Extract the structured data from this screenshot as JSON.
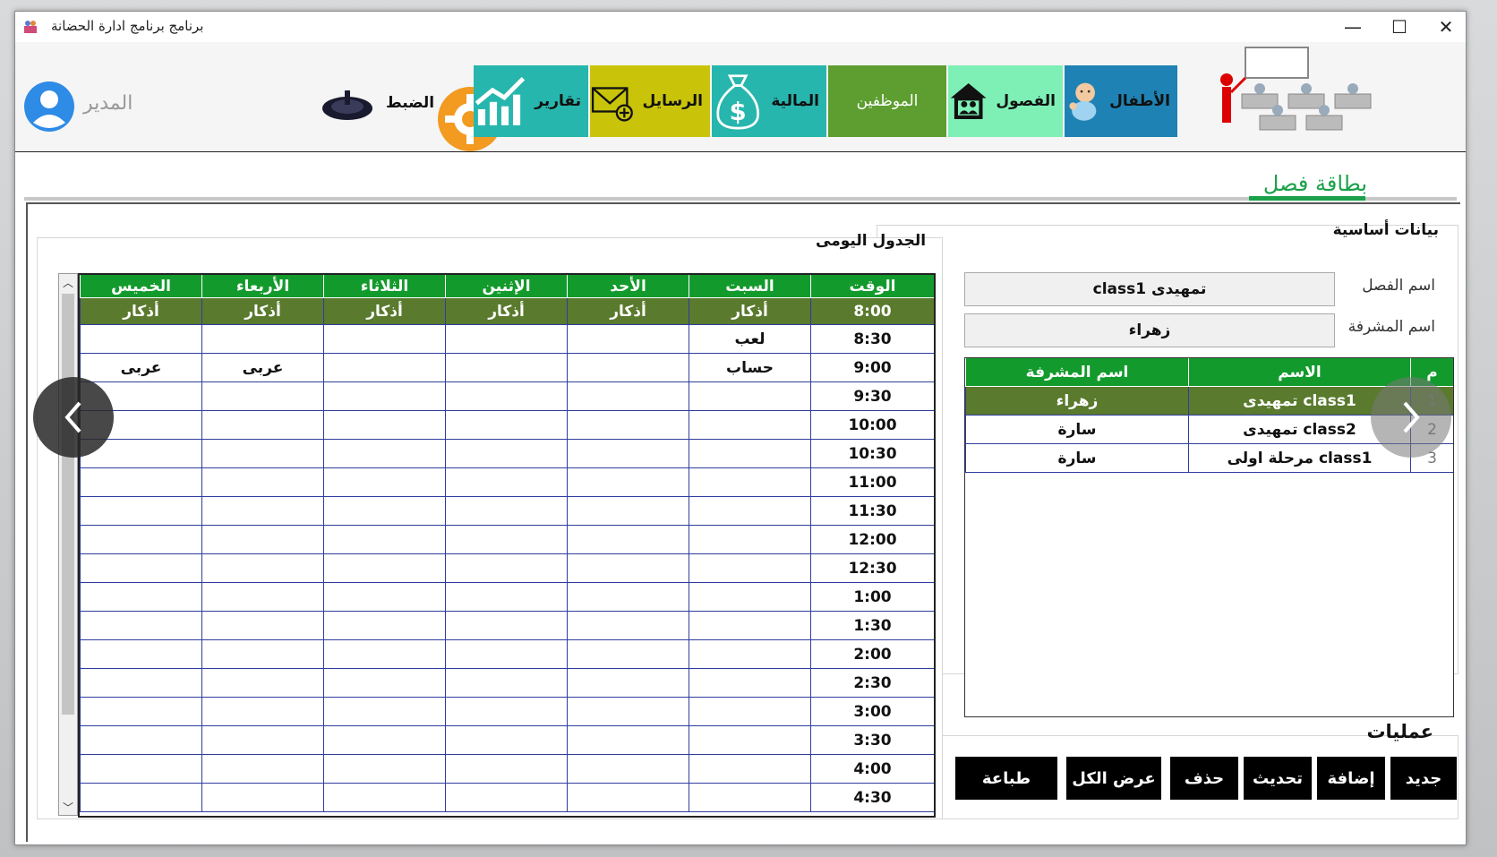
{
  "window": {
    "title": "برنامج  برنامج ادارة الحضانة",
    "controls": {
      "minimize": "—",
      "maximize": "☐",
      "close": "✕"
    }
  },
  "toolbar": {
    "user": "المدير",
    "settings": "الضبط",
    "reports": "تقارير",
    "messages": "الرسايل",
    "finance": "المالية",
    "employees": "الموظفين",
    "classes": "الفصول",
    "children": "الأطفال",
    "colors": {
      "reports": "#27b6ad",
      "messages": "#c9c40a",
      "finance": "#27b6ad",
      "employees": "#5e9e31",
      "classes": "#7ef0b6",
      "children": "#1e82b4"
    }
  },
  "page": {
    "title": "بطاقة فصل"
  },
  "basic_data": {
    "title": "بيانات أساسية",
    "class_name_label": "اسم الفصل",
    "class_name_value": "تمهيدى class1",
    "supervisor_label": "اسم المشرفة",
    "supervisor_value": "زهراء"
  },
  "class_table": {
    "headers": {
      "num": "م",
      "name": "الاسم",
      "supervisor": "اسم المشرفة"
    },
    "rows": [
      {
        "num": "1",
        "name": "تمهيدى class1",
        "supervisor": "زهراء"
      },
      {
        "num": "2",
        "name": "تمهيدى class2",
        "supervisor": "سارة"
      },
      {
        "num": "3",
        "name": "مرحلة اولى class1",
        "supervisor": "سارة"
      }
    ]
  },
  "operations": {
    "title": "عمليات",
    "new": "جديد",
    "add": "إضافة",
    "update": "تحديث",
    "delete": "حذف",
    "show_all": "عرض الكل",
    "print": "طباعة"
  },
  "schedule": {
    "title": "الجدول اليومى",
    "headers": [
      "الوقت",
      "السبت",
      "الأحد",
      "الإثنين",
      "الثلاثاء",
      "الأربعاء",
      "الخميس"
    ],
    "rows": [
      [
        "8:00",
        "أذكار",
        "أذكار",
        "أذكار",
        "أذكار",
        "أذكار",
        "أذكار"
      ],
      [
        "8:30",
        "لعب",
        "",
        "",
        "",
        "",
        ""
      ],
      [
        "9:00",
        "حساب",
        "",
        "",
        "",
        "عربى",
        "عربى"
      ],
      [
        "9:30",
        "",
        "",
        "",
        "",
        "",
        ""
      ],
      [
        "10:00",
        "",
        "",
        "",
        "",
        "",
        ""
      ],
      [
        "10:30",
        "",
        "",
        "",
        "",
        "",
        ""
      ],
      [
        "11:00",
        "",
        "",
        "",
        "",
        "",
        ""
      ],
      [
        "11:30",
        "",
        "",
        "",
        "",
        "",
        ""
      ],
      [
        "12:00",
        "",
        "",
        "",
        "",
        "",
        ""
      ],
      [
        "12:30",
        "",
        "",
        "",
        "",
        "",
        ""
      ],
      [
        "1:00",
        "",
        "",
        "",
        "",
        "",
        ""
      ],
      [
        "1:30",
        "",
        "",
        "",
        "",
        "",
        ""
      ],
      [
        "2:00",
        "",
        "",
        "",
        "",
        "",
        ""
      ],
      [
        "2:30",
        "",
        "",
        "",
        "",
        "",
        ""
      ],
      [
        "3:00",
        "",
        "",
        "",
        "",
        "",
        ""
      ],
      [
        "3:30",
        "",
        "",
        "",
        "",
        "",
        ""
      ],
      [
        "4:00",
        "",
        "",
        "",
        "",
        "",
        ""
      ],
      [
        "4:30",
        "",
        "",
        "",
        "",
        "",
        ""
      ]
    ]
  }
}
